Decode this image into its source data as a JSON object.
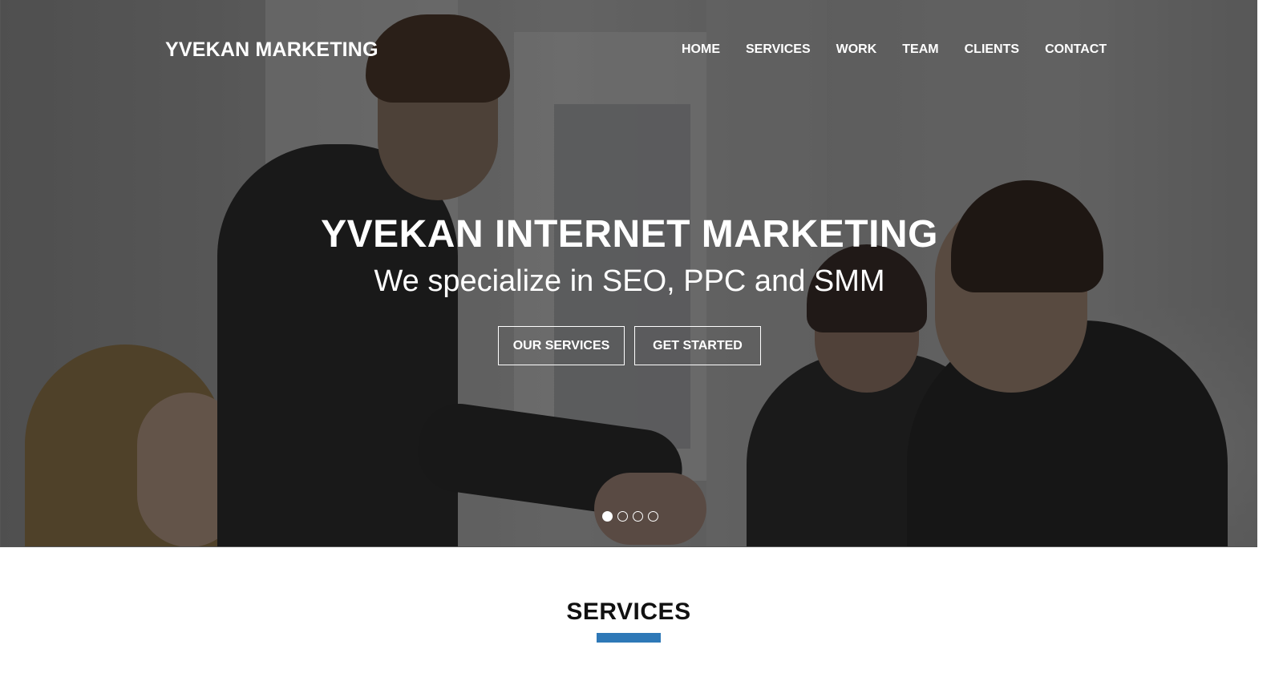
{
  "header": {
    "brand": "YVEKAN MARKETING",
    "nav": [
      "HOME",
      "SERVICES",
      "WORK",
      "TEAM",
      "CLIENTS",
      "CONTACT"
    ]
  },
  "hero": {
    "title": "YVEKAN INTERNET MARKETING",
    "subtitle": "We specialize in SEO, PPC and SMM",
    "buttons": {
      "our_services": "OUR SERVICES",
      "get_started": "GET STARTED"
    },
    "slider": {
      "slide_count": 4,
      "active_index": 0
    },
    "background_image": "business-handshake-photo"
  },
  "services": {
    "heading": "SERVICES"
  },
  "colors": {
    "accent": "#2e78b7",
    "heading_text": "#111111",
    "hero_text": "#ffffff"
  }
}
